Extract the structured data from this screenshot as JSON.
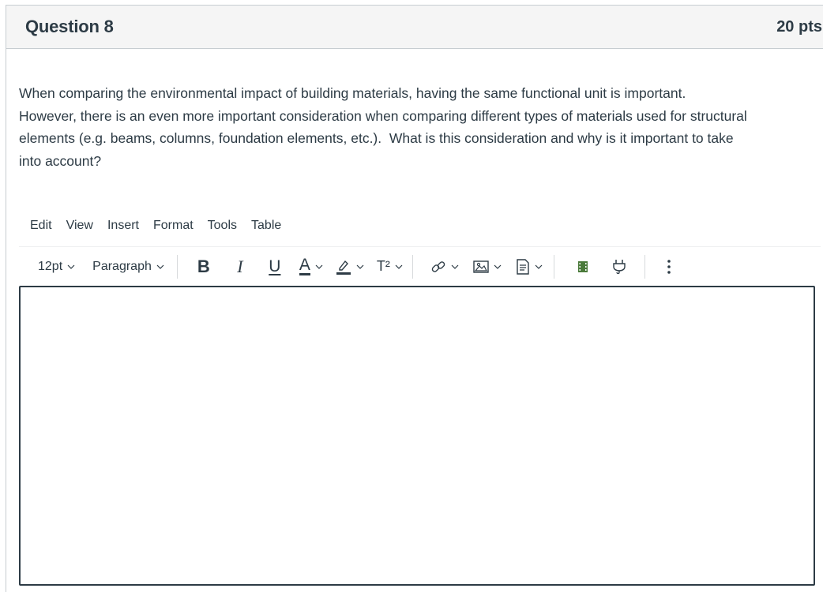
{
  "question": {
    "title": "Question 8",
    "points": "20 pts",
    "text_lines": [
      "When comparing the environmental impact of building materials, having the same functional unit is important.",
      "However, there is an even more important consideration when comparing different types of materials used for structural",
      "elements (e.g. beams, columns, foundation elements, etc.).  What is this consideration and why is it important to take",
      "into account?"
    ]
  },
  "editor": {
    "menu": [
      "Edit",
      "View",
      "Insert",
      "Format",
      "Tools",
      "Table"
    ],
    "font_size": "12pt",
    "block_format": "Paragraph",
    "superscript_label": "T²",
    "bold_label": "B",
    "italic_label": "I",
    "underline_label": "U",
    "text_color_label": "A",
    "body_text": ""
  },
  "colors": {
    "text": "#2d3b45",
    "border": "#c7cdd1",
    "header_bg": "#f5f5f5",
    "media_icon": "#4a7a3a"
  }
}
